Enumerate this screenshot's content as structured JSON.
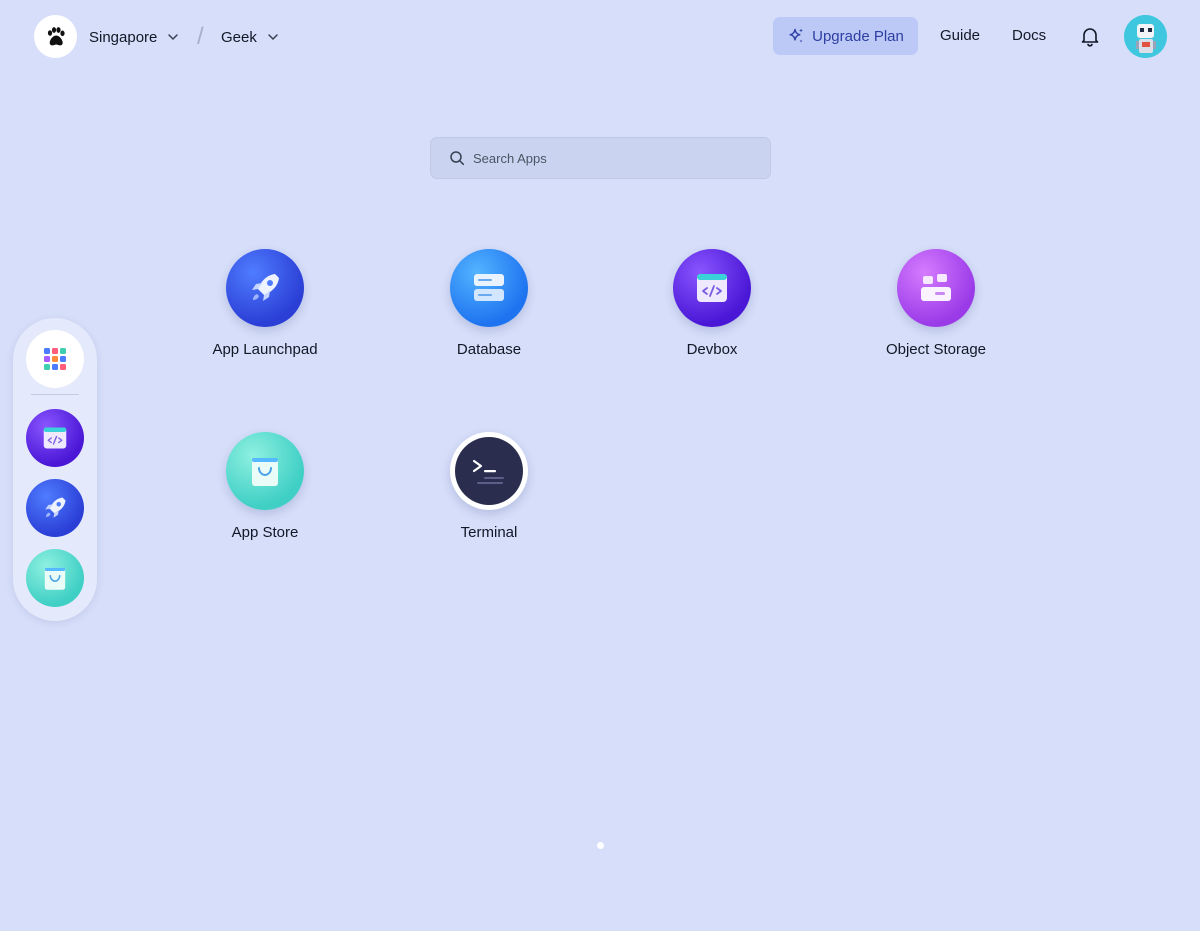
{
  "header": {
    "logo_icon": "paw-icon",
    "region": "Singapore",
    "separator": "/",
    "workspace": "Geek",
    "upgrade_label": "Upgrade Plan",
    "links": {
      "guide": "Guide",
      "docs": "Docs"
    },
    "notification_icon": "bell-icon",
    "avatar_icon": "robot-avatar"
  },
  "search": {
    "placeholder": "Search Apps"
  },
  "apps": [
    {
      "label": "App Launchpad",
      "icon": "rocket-icon"
    },
    {
      "label": "Database",
      "icon": "database-icon"
    },
    {
      "label": "Devbox",
      "icon": "devbox-icon"
    },
    {
      "label": "Object Storage",
      "icon": "object-storage-icon"
    },
    {
      "label": "App Store",
      "icon": "shopping-bag-icon"
    },
    {
      "label": "Terminal",
      "icon": "terminal-icon"
    }
  ],
  "dock": {
    "items": [
      {
        "icon": "grid-icon"
      },
      {
        "icon": "devbox-icon"
      },
      {
        "icon": "rocket-icon"
      },
      {
        "icon": "shopping-bag-icon"
      }
    ]
  },
  "pager": {
    "pages": 1,
    "current": 1
  },
  "colors": {
    "background": "#d6def9",
    "accent": "#2d3fa3",
    "upgrade_bg": "#bcc8f5"
  }
}
